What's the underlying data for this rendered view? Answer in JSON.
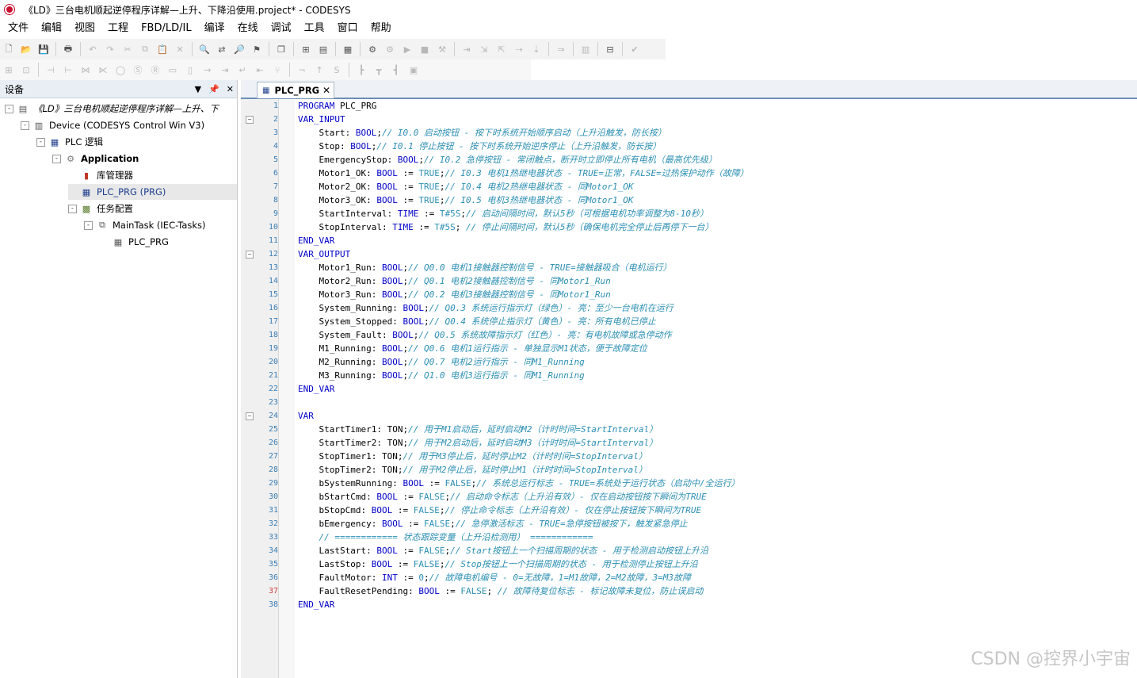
{
  "window": {
    "title": "《LD》三台电机顺起逆停程序详解—上升、下降沿使用.project* - CODESYS"
  },
  "menu": [
    "文件",
    "编辑",
    "视图",
    "工程",
    "FBD/LD/IL",
    "编译",
    "在线",
    "调试",
    "工具",
    "窗口",
    "帮助"
  ],
  "side": {
    "title": "设备",
    "pin_label": "▼",
    "close_label": "✕",
    "tree": [
      {
        "label": "《LD》三台电机顺起逆停程序详解—上升、下",
        "icon": "project-icon",
        "expand": "-"
      },
      {
        "label": "Device (CODESYS Control Win V3)",
        "icon": "device-icon",
        "expand": "-"
      },
      {
        "label": "PLC 逻辑",
        "icon": "plc-logic-icon",
        "expand": "-"
      },
      {
        "label": "Application",
        "icon": "gear-icon",
        "expand": "-"
      },
      {
        "label": "库管理器",
        "icon": "library-icon",
        "expand": ""
      },
      {
        "label": "PLC_PRG (PRG)",
        "icon": "prg-icon",
        "expand": ""
      },
      {
        "label": "任务配置",
        "icon": "task-config-icon",
        "expand": "-"
      },
      {
        "label": "MainTask (IEC-Tasks)",
        "icon": "task-icon",
        "expand": "-"
      },
      {
        "label": "PLC_PRG",
        "icon": "prg-call-icon",
        "expand": ""
      }
    ]
  },
  "editor": {
    "tab_label": "PLC_PRG",
    "lines": [
      [
        [
          "kw",
          "PROGRAM "
        ],
        [
          "id",
          "PLC_PRG"
        ]
      ],
      [
        [
          "kw",
          "VAR_INPUT"
        ]
      ],
      [
        [
          "id",
          "    Start: "
        ],
        [
          "kw",
          "BOOL"
        ],
        [
          "id",
          ";"
        ],
        [
          "cm",
          "// I0.0 启动按钮 - 按下时系统开始顺序启动（上升沿触发，防长按）"
        ]
      ],
      [
        [
          "id",
          "    Stop: "
        ],
        [
          "kw",
          "BOOL"
        ],
        [
          "id",
          ";"
        ],
        [
          "cm",
          "// I0.1 停止按钮 - 按下时系统开始逆序停止（上升沿触发，防长按）"
        ]
      ],
      [
        [
          "id",
          "    EmergencyStop: "
        ],
        [
          "kw",
          "BOOL"
        ],
        [
          "id",
          ";"
        ],
        [
          "cm",
          "// I0.2 急停按钮 - 常闭触点，断开时立即停止所有电机（最高优先级）"
        ]
      ],
      [
        [
          "id",
          "    Motor1_OK: "
        ],
        [
          "kw",
          "BOOL"
        ],
        [
          "id",
          " := "
        ],
        [
          "vl",
          "TRUE"
        ],
        [
          "id",
          ";"
        ],
        [
          "cm",
          "// I0.3 电机1热继电器状态 - TRUE=正常，FALSE=过热保护动作（故障）"
        ]
      ],
      [
        [
          "id",
          "    Motor2_OK: "
        ],
        [
          "kw",
          "BOOL"
        ],
        [
          "id",
          " := "
        ],
        [
          "vl",
          "TRUE"
        ],
        [
          "id",
          ";"
        ],
        [
          "cm",
          "// I0.4 电机2热继电器状态 - 同Motor1_OK"
        ]
      ],
      [
        [
          "id",
          "    Motor3_OK: "
        ],
        [
          "kw",
          "BOOL"
        ],
        [
          "id",
          " := "
        ],
        [
          "vl",
          "TRUE"
        ],
        [
          "id",
          ";"
        ],
        [
          "cm",
          "// I0.5 电机3热继电器状态 - 同Motor1_OK"
        ]
      ],
      [
        [
          "id",
          "    StartInterval: "
        ],
        [
          "kw",
          "TIME"
        ],
        [
          "id",
          " := "
        ],
        [
          "vl",
          "T#5S"
        ],
        [
          "id",
          ";"
        ],
        [
          "cm",
          "// 启动间隔时间，默认5秒（可根据电机功率调整为8-10秒）"
        ]
      ],
      [
        [
          "id",
          "    StopInterval: "
        ],
        [
          "kw",
          "TIME"
        ],
        [
          "id",
          " := "
        ],
        [
          "vl",
          "T#5S"
        ],
        [
          "id",
          "; "
        ],
        [
          "cm",
          "// 停止间隔时间，默认5秒（确保电机完全停止后再停下一台）"
        ]
      ],
      [
        [
          "kw",
          "END_VAR"
        ]
      ],
      [
        [
          "kw",
          "VAR_OUTPUT"
        ]
      ],
      [
        [
          "id",
          "    Motor1_Run: "
        ],
        [
          "kw",
          "BOOL"
        ],
        [
          "id",
          ";"
        ],
        [
          "cm",
          "// Q0.0 电机1接触器控制信号 - TRUE=接触器吸合（电机运行）"
        ]
      ],
      [
        [
          "id",
          "    Motor2_Run: "
        ],
        [
          "kw",
          "BOOL"
        ],
        [
          "id",
          ";"
        ],
        [
          "cm",
          "// Q0.1 电机2接触器控制信号 - 同Motor1_Run"
        ]
      ],
      [
        [
          "id",
          "    Motor3_Run: "
        ],
        [
          "kw",
          "BOOL"
        ],
        [
          "id",
          ";"
        ],
        [
          "cm",
          "// Q0.2 电机3接触器控制信号 - 同Motor1_Run"
        ]
      ],
      [
        [
          "id",
          "    System_Running: "
        ],
        [
          "kw",
          "BOOL"
        ],
        [
          "id",
          ";"
        ],
        [
          "cm",
          "// Q0.3 系统运行指示灯（绿色）- 亮：至少一台电机在运行"
        ]
      ],
      [
        [
          "id",
          "    System_Stopped: "
        ],
        [
          "kw",
          "BOOL"
        ],
        [
          "id",
          ";"
        ],
        [
          "cm",
          "// Q0.4 系统停止指示灯（黄色）- 亮：所有电机已停止"
        ]
      ],
      [
        [
          "id",
          "    System_Fault: "
        ],
        [
          "kw",
          "BOOL"
        ],
        [
          "id",
          ";"
        ],
        [
          "cm",
          "// Q0.5 系统故障指示灯（红色）- 亮：有电机故障或急停动作"
        ]
      ],
      [
        [
          "id",
          "    M1_Running: "
        ],
        [
          "kw",
          "BOOL"
        ],
        [
          "id",
          ";"
        ],
        [
          "cm",
          "// Q0.6 电机1运行指示 - 单独显示M1状态，便于故障定位"
        ]
      ],
      [
        [
          "id",
          "    M2_Running: "
        ],
        [
          "kw",
          "BOOL"
        ],
        [
          "id",
          ";"
        ],
        [
          "cm",
          "// Q0.7 电机2运行指示 - 同M1_Running"
        ]
      ],
      [
        [
          "id",
          "    M3_Running: "
        ],
        [
          "kw",
          "BOOL"
        ],
        [
          "id",
          ";"
        ],
        [
          "cm",
          "// Q1.0 电机3运行指示 - 同M1_Running"
        ]
      ],
      [
        [
          "kw",
          "END_VAR"
        ]
      ],
      [],
      [
        [
          "kw",
          "VAR"
        ]
      ],
      [
        [
          "id",
          "    StartTimer1: TON;"
        ],
        [
          "cm",
          "// 用于M1启动后，延时启动M2（计时时间=StartInterval）"
        ]
      ],
      [
        [
          "id",
          "    StartTimer2: TON;"
        ],
        [
          "cm",
          "// 用于M2启动后，延时启动M3（计时时间=StartInterval）"
        ]
      ],
      [
        [
          "id",
          "    StopTimer1: TON;"
        ],
        [
          "cm",
          "// 用于M3停止后，延时停止M2（计时时间=StopInterval）"
        ]
      ],
      [
        [
          "id",
          "    StopTimer2: TON;"
        ],
        [
          "cm",
          "// 用于M2停止后，延时停止M1（计时时间=StopInterval）"
        ]
      ],
      [
        [
          "id",
          "    bSystemRunning: "
        ],
        [
          "kw",
          "BOOL"
        ],
        [
          "id",
          " := "
        ],
        [
          "vl",
          "FALSE"
        ],
        [
          "id",
          ";"
        ],
        [
          "cm",
          "// 系统总运行标志 - TRUE=系统处于运行状态（启动中/全运行）"
        ]
      ],
      [
        [
          "id",
          "    bStartCmd: "
        ],
        [
          "kw",
          "BOOL"
        ],
        [
          "id",
          " := "
        ],
        [
          "vl",
          "FALSE"
        ],
        [
          "id",
          ";"
        ],
        [
          "cm",
          "// 启动命令标志（上升沿有效）- 仅在启动按钮按下瞬间为TRUE"
        ]
      ],
      [
        [
          "id",
          "    bStopCmd: "
        ],
        [
          "kw",
          "BOOL"
        ],
        [
          "id",
          " := "
        ],
        [
          "vl",
          "FALSE"
        ],
        [
          "id",
          ";"
        ],
        [
          "cm",
          "// 停止命令标志（上升沿有效）- 仅在停止按钮按下瞬间为TRUE"
        ]
      ],
      [
        [
          "id",
          "    bEmergency: "
        ],
        [
          "kw",
          "BOOL"
        ],
        [
          "id",
          " := "
        ],
        [
          "vl",
          "FALSE"
        ],
        [
          "id",
          ";"
        ],
        [
          "cm",
          "// 急停激活标志 - TRUE=急停按钮被按下，触发紧急停止"
        ]
      ],
      [
        [
          "id",
          "    "
        ],
        [
          "cm",
          "// ============ 状态跟踪变量（上升沿检测用） ============"
        ]
      ],
      [
        [
          "id",
          "    LastStart: "
        ],
        [
          "kw",
          "BOOL"
        ],
        [
          "id",
          " := "
        ],
        [
          "vl",
          "FALSE"
        ],
        [
          "id",
          ";"
        ],
        [
          "cm",
          "// Start按钮上一个扫描周期的状态 - 用于检测启动按钮上升沿"
        ]
      ],
      [
        [
          "id",
          "    LastStop: "
        ],
        [
          "kw",
          "BOOL"
        ],
        [
          "id",
          " := "
        ],
        [
          "vl",
          "FALSE"
        ],
        [
          "id",
          ";"
        ],
        [
          "cm",
          "// Stop按钮上一个扫描周期的状态 - 用于检测停止按钮上升沿"
        ]
      ],
      [
        [
          "id",
          "    FaultMotor: "
        ],
        [
          "kw",
          "INT"
        ],
        [
          "id",
          " := "
        ],
        [
          "vl",
          "0"
        ],
        [
          "id",
          ";"
        ],
        [
          "cm",
          "// 故障电机编号 - 0=无故障，1=M1故障，2=M2故障，3=M3故障"
        ]
      ],
      [
        [
          "id",
          "    FaultResetPending: "
        ],
        [
          "kw",
          "BOOL"
        ],
        [
          "id",
          " := "
        ],
        [
          "vl",
          "FALSE"
        ],
        [
          "id",
          "; "
        ],
        [
          "cm",
          "// 故障待复位标志 - 标记故障未复位，防止误启动"
        ]
      ],
      [
        [
          "kw",
          "END_VAR"
        ]
      ]
    ],
    "fold_lines": [
      2,
      12,
      24
    ],
    "red_lines": [
      37
    ]
  },
  "watermark": "CSDN @控界小宇宙"
}
